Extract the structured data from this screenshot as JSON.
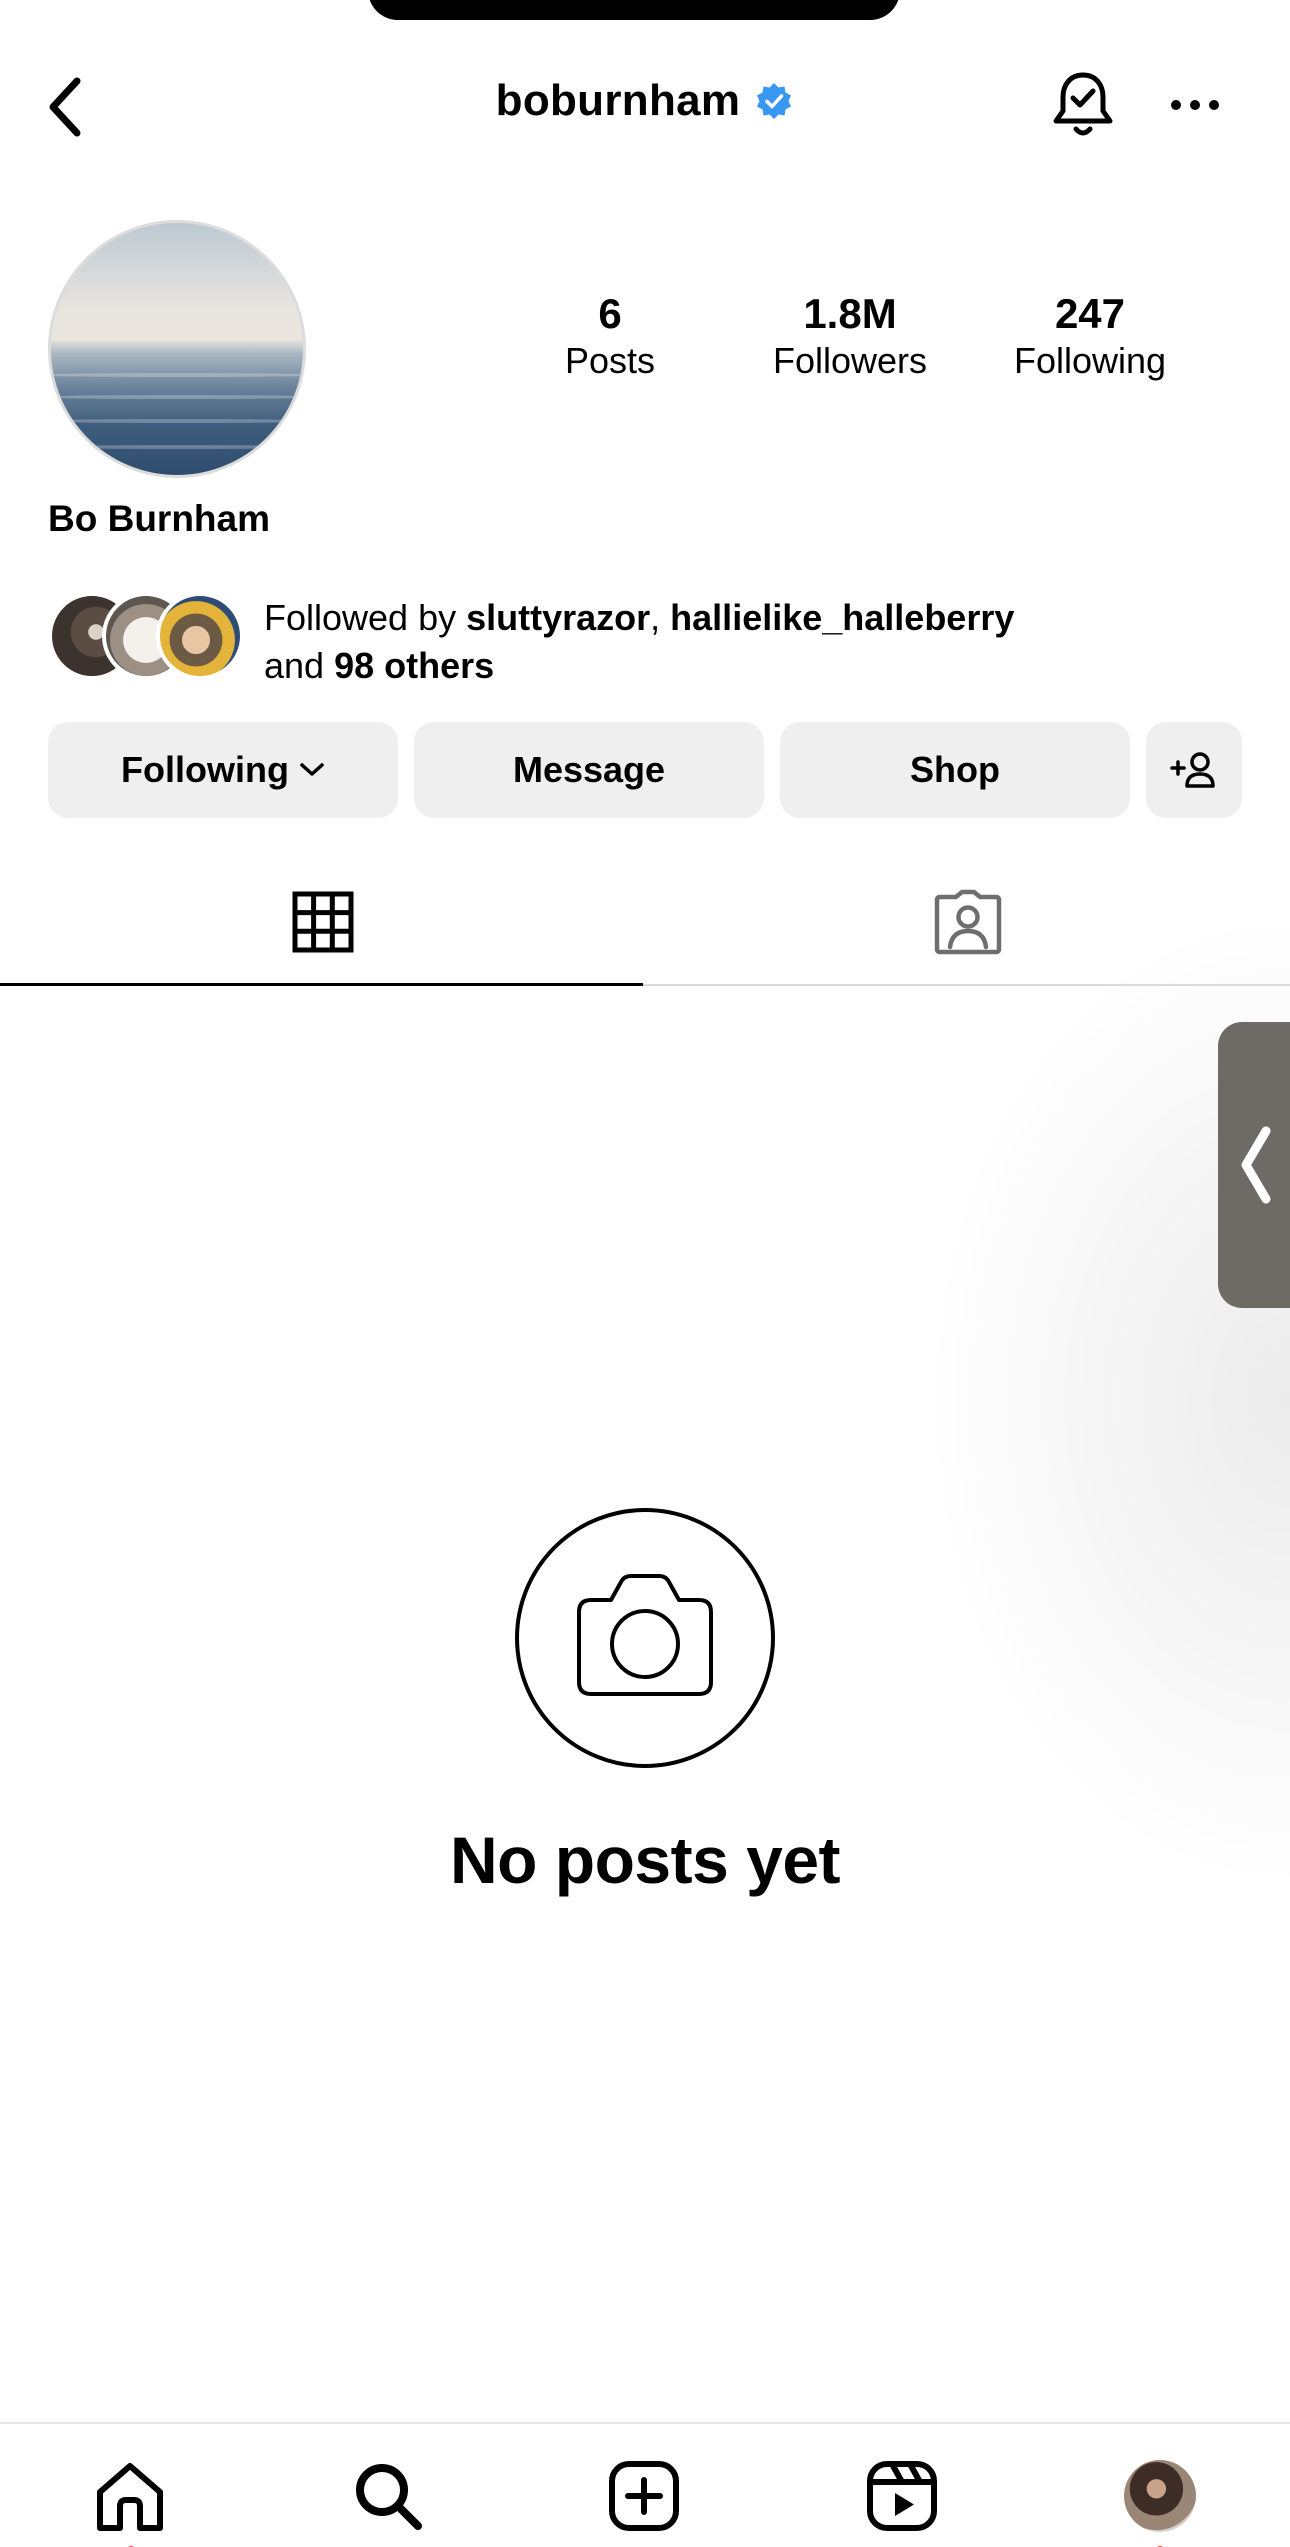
{
  "header": {
    "username": "boburnham",
    "verified": true
  },
  "profile": {
    "display_name": "Bo Burnham",
    "stats": [
      {
        "value": "6",
        "label": "Posts"
      },
      {
        "value": "1.8M",
        "label": "Followers"
      },
      {
        "value": "247",
        "label": "Following"
      }
    ],
    "followed_by": {
      "prefix": "Followed by ",
      "user1": "sluttyrazor",
      "separator": ", ",
      "user2": "hallielike_halleberry",
      "and_text": "and ",
      "others": "98 others"
    }
  },
  "buttons": {
    "following": "Following",
    "message": "Message",
    "shop": "Shop"
  },
  "empty_state": {
    "text": "No posts yet"
  },
  "colors": {
    "verified_blue": "#3897f0",
    "button_bg": "#efefef",
    "notification_red": "#ff3040"
  },
  "icons": {
    "back": "chevron-left-icon",
    "bell": "bell-check-icon",
    "more": "more-horizontal-icon",
    "grid": "grid-icon",
    "tagged": "tagged-person-icon",
    "camera": "camera-icon",
    "home": "home-icon",
    "search": "search-icon",
    "create": "plus-square-icon",
    "reels": "reels-icon"
  }
}
